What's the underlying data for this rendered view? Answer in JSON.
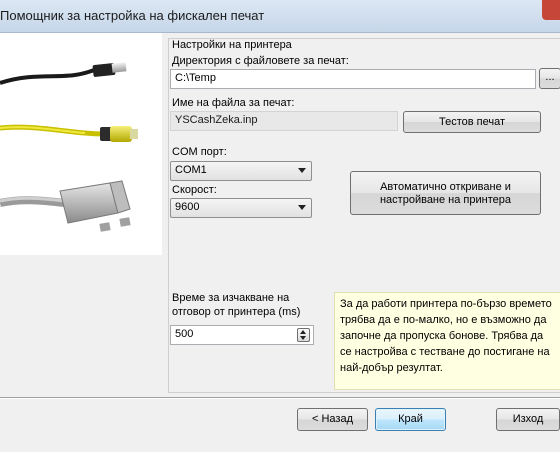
{
  "window": {
    "title": "Помощник за настройка на фискален печат"
  },
  "printer_settings": {
    "group_title": "Настройки на принтера",
    "dir_label": "Директория с файловете за печат:",
    "dir_value": "C:\\Temp",
    "browse_label": "...",
    "file_label": "Име на файла за печат:",
    "file_value": "YSCashZeka.inp",
    "test_button": "Тестов печат",
    "com_label": "COM порт:",
    "com_value": "COM1",
    "speed_label": "Скорост:",
    "speed_value": "9600",
    "auto_button_line1": "Автоматично откриване и",
    "auto_button_line2": "настройване на принтера",
    "timeout_label_line1": "Време за изчакване на",
    "timeout_label_line2": "отговор от принтера (ms)",
    "timeout_value": "500",
    "note_lines": [
      "За да работи принтера по-бързо времето",
      "трябва да е по-малко, но е възможно да",
      "започне да пропуска бонове. Трябва да",
      "се настройва с тестване до постигане на",
      "най-добър резултат."
    ]
  },
  "footer": {
    "back": "< Назад",
    "finish": "Край",
    "exit": "Изход"
  },
  "image": {
    "name": "printer-cables-illustration"
  }
}
